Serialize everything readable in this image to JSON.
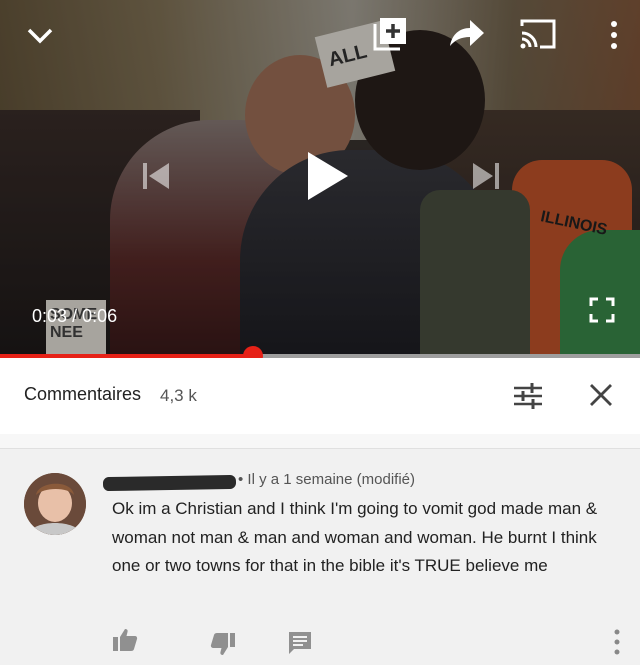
{
  "player": {
    "time_current": "0:03",
    "time_total": "0:06",
    "time_separator": "/",
    "progress_fraction": 0.396,
    "accent_color": "#e62117",
    "sign_text_top": "ALL",
    "sign_text_bottom": "SOME\nNEE",
    "jacket_text": "ILLINOIS",
    "icons": [
      "chevron-down-icon",
      "add-to-playlist-icon",
      "share-icon",
      "cast-icon",
      "more-vert-icon",
      "previous-icon",
      "play-icon",
      "next-icon",
      "fullscreen-icon"
    ]
  },
  "comments_panel": {
    "title": "Commentaires",
    "count": "4,3 k",
    "icons": [
      "sort-icon",
      "close-icon"
    ]
  },
  "comment": {
    "meta": "• Il y a 1 semaine (modifié)",
    "text": "Ok im a Christian and I think I'm going to vomit god made man & woman not man & man and woman and woman. He burnt I think one or two towns for that in the bible it's TRUE believe me",
    "icons": [
      "thumb-up-icon",
      "thumb-down-icon",
      "reply-icon",
      "more-vert-icon"
    ]
  }
}
